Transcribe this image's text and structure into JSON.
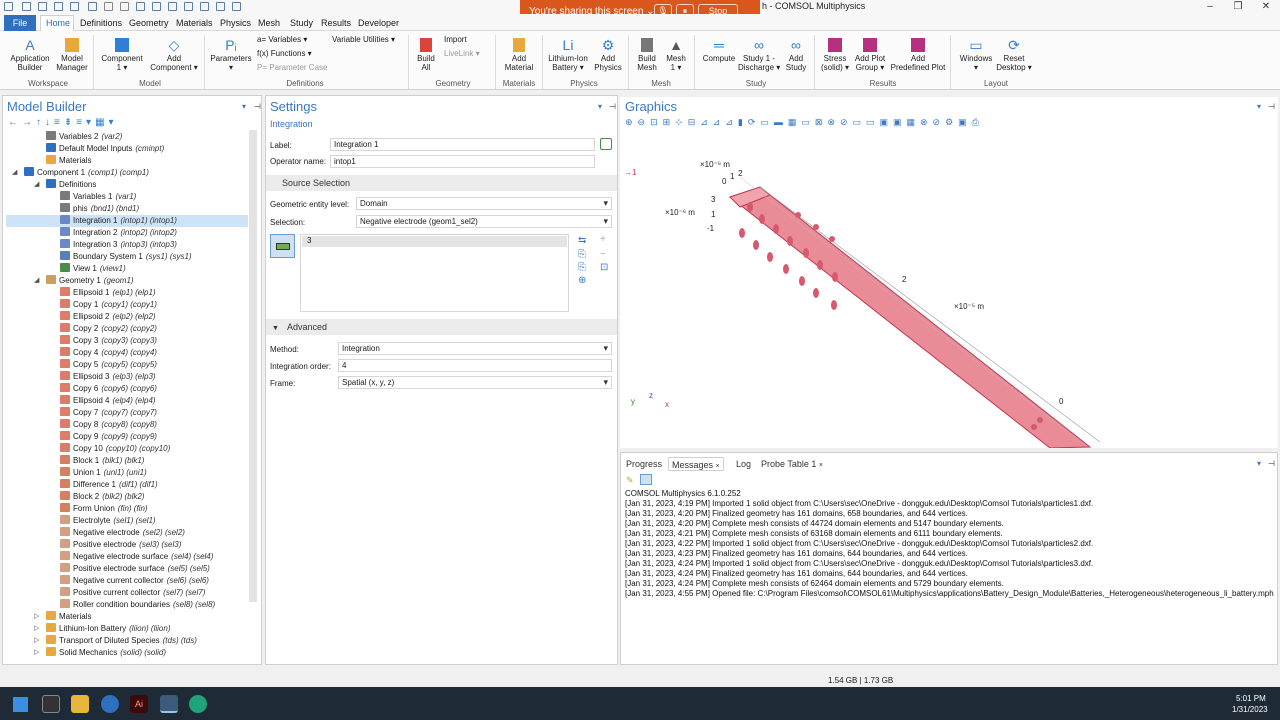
{
  "window": {
    "title": "h - COMSOL Multiphysics",
    "controls": [
      "–",
      "❐",
      "✕"
    ]
  },
  "share_bar": {
    "message": "You're sharing this screen ⌄",
    "stop_label": "Stop",
    "mic": "🎙",
    "pause": "⏸"
  },
  "menu": {
    "file": "File",
    "items": [
      "Home",
      "Definitions",
      "Geometry",
      "Materials",
      "Physics",
      "Mesh",
      "Study",
      "Results",
      "Developer"
    ]
  },
  "ribbon": {
    "application_builder": "Application\nBuilder",
    "model_manager": "Model\nManager",
    "component": "Component\n1 ▾",
    "add_component": "Add\nComponent ▾",
    "parameters": "Parameters\n▾",
    "variables": "a= Variables ▾",
    "functions": "f(x) Functions ▾",
    "parameter_case": "P= Parameter Case",
    "variable_utilities": "Variable Utilities ▾",
    "build_all": "Build\nAll",
    "import": "Import",
    "livelink": "LiveLink ▾",
    "add_material": "Add\nMaterial",
    "battery": "Lithium-Ion\nBattery ▾",
    "add_physics": "Add\nPhysics",
    "build_mesh": "Build\nMesh",
    "mesh1": "Mesh\n1 ▾",
    "compute": "Compute",
    "study1": "Study 1 -\nDischarge ▾",
    "add_study": "Add\nStudy",
    "stress": "Stress\n(solid) ▾",
    "add_plot_group": "Add Plot\nGroup ▾",
    "add_predefined_plot": "Add\nPredefined Plot",
    "windows": "Windows\n▾",
    "reset_desktop": "Reset\nDesktop ▾",
    "groups": [
      "Workspace",
      "Model",
      "Definitions",
      "Geometry",
      "Materials",
      "Physics",
      "Mesh",
      "Study",
      "Results",
      "Layout"
    ]
  },
  "model_builder": {
    "title": "Model Builder",
    "tree": [
      {
        "label": "Variables 2",
        "tag": "(var2)",
        "indent": 0,
        "icon": "var"
      },
      {
        "label": "Default Model Inputs",
        "tag": "(cminpt)",
        "indent": 0,
        "icon": "blue"
      },
      {
        "label": "Materials",
        "tag": "",
        "indent": 0,
        "icon": "mat"
      },
      {
        "label": "Component 1",
        "tag": "(comp1) (comp1)",
        "indent": -1,
        "icon": "comp"
      },
      {
        "label": "Definitions",
        "tag": "",
        "indent": 0,
        "icon": "blue"
      },
      {
        "label": "Variables 1",
        "tag": "(var1)",
        "indent": 1,
        "icon": "var"
      },
      {
        "label": "phis",
        "tag": "(bnd1) (bnd1)",
        "indent": 1,
        "icon": "var"
      },
      {
        "label": "Integration 1",
        "tag": "(intop1) (intop1)",
        "indent": 1,
        "icon": "fn",
        "selected": true
      },
      {
        "label": "Integration 2",
        "tag": "(intop2) (intop2)",
        "indent": 1,
        "icon": "fn"
      },
      {
        "label": "Integration 3",
        "tag": "(intop3) (intop3)",
        "indent": 1,
        "icon": "fn"
      },
      {
        "label": "Boundary System 1",
        "tag": "(sys1) (sys1)",
        "indent": 1,
        "icon": "sys"
      },
      {
        "label": "View 1",
        "tag": "(view1)",
        "indent": 1,
        "icon": "view"
      },
      {
        "label": "Geometry 1",
        "tag": "(geom1)",
        "indent": 0,
        "icon": "geom"
      },
      {
        "label": "Ellipsoid 1",
        "tag": "(elp1) (elp1)",
        "indent": 1,
        "icon": "ell"
      },
      {
        "label": "Copy 1",
        "tag": "(copy1) (copy1)",
        "indent": 1,
        "icon": "copy"
      },
      {
        "label": "Ellipsoid 2",
        "tag": "(elp2) (elp2)",
        "indent": 1,
        "icon": "ell"
      },
      {
        "label": "Copy 2",
        "tag": "(copy2) (copy2)",
        "indent": 1,
        "icon": "copy"
      },
      {
        "label": "Copy 3",
        "tag": "(copy3) (copy3)",
        "indent": 1,
        "icon": "copy"
      },
      {
        "label": "Copy 4",
        "tag": "(copy4) (copy4)",
        "indent": 1,
        "icon": "copy"
      },
      {
        "label": "Copy 5",
        "tag": "(copy5) (copy5)",
        "indent": 1,
        "icon": "copy"
      },
      {
        "label": "Ellipsoid 3",
        "tag": "(elp3) (elp3)",
        "indent": 1,
        "icon": "ell"
      },
      {
        "label": "Copy 6",
        "tag": "(copy6) (copy6)",
        "indent": 1,
        "icon": "copy"
      },
      {
        "label": "Ellipsoid 4",
        "tag": "(elp4) (elp4)",
        "indent": 1,
        "icon": "ell"
      },
      {
        "label": "Copy 7",
        "tag": "(copy7) (copy7)",
        "indent": 1,
        "icon": "copy"
      },
      {
        "label": "Copy 8",
        "tag": "(copy8) (copy8)",
        "indent": 1,
        "icon": "copy"
      },
      {
        "label": "Copy 9",
        "tag": "(copy9) (copy9)",
        "indent": 1,
        "icon": "copy"
      },
      {
        "label": "Copy 10",
        "tag": "(copy10) (copy10)",
        "indent": 1,
        "icon": "copy"
      },
      {
        "label": "Block 1",
        "tag": "(blk1) (blk1)",
        "indent": 1,
        "icon": "block"
      },
      {
        "label": "Union 1",
        "tag": "(uni1) (uni1)",
        "indent": 1,
        "icon": "union"
      },
      {
        "label": "Difference 1",
        "tag": "(dif1) (dif1)",
        "indent": 1,
        "icon": "union"
      },
      {
        "label": "Block 2",
        "tag": "(blk2) (blk2)",
        "indent": 1,
        "icon": "block"
      },
      {
        "label": "Form Union",
        "tag": "(fin) (fin)",
        "indent": 1,
        "icon": "block"
      },
      {
        "label": "Electrolyte",
        "tag": "(sel1) (sel1)",
        "indent": 1,
        "icon": "sel"
      },
      {
        "label": "Negative electrode",
        "tag": "(sel2) (sel2)",
        "indent": 1,
        "icon": "sel"
      },
      {
        "label": "Positive electrode",
        "tag": "(sel3) (sel3)",
        "indent": 1,
        "icon": "sel"
      },
      {
        "label": "Negative electrode surface",
        "tag": "(sel4) (sel4)",
        "indent": 1,
        "icon": "sel"
      },
      {
        "label": "Positive electrode surface",
        "tag": "(sel5) (sel5)",
        "indent": 1,
        "icon": "sel"
      },
      {
        "label": "Negative current collector",
        "tag": "(sel6) (sel6)",
        "indent": 1,
        "icon": "sel"
      },
      {
        "label": "Positive current collector",
        "tag": "(sel7) (sel7)",
        "indent": 1,
        "icon": "sel"
      },
      {
        "label": "Roller condition boundaries",
        "tag": "(sel8) (sel8)",
        "indent": 1,
        "icon": "sel"
      },
      {
        "label": "Materials",
        "tag": "",
        "indent": 0,
        "icon": "mat",
        "collapsed": true
      },
      {
        "label": "Lithium-Ion Battery",
        "tag": "(liion) (liion)",
        "indent": 0,
        "icon": "phys",
        "collapsed": true
      },
      {
        "label": "Transport of Diluted Species",
        "tag": "(tds) (tds)",
        "indent": 0,
        "icon": "phys",
        "collapsed": true
      },
      {
        "label": "Solid Mechanics",
        "tag": "(solid) (solid)",
        "indent": 0,
        "icon": "phys",
        "collapsed": true
      }
    ]
  },
  "settings": {
    "title": "Settings",
    "subtitle": "Integration",
    "label_caption": "Label:",
    "label_value": "Integration 1",
    "operator_caption": "Operator name:",
    "operator_value": "intop1",
    "source_selection": "Source Selection",
    "entity_level_caption": "Geometric entity level:",
    "entity_level_value": "Domain",
    "selection_caption": "Selection:",
    "selection_value": "Negative electrode (geom1_sel2)",
    "selection_list": [
      "3"
    ],
    "advanced": "Advanced",
    "method_caption": "Method:",
    "method_value": "Integration",
    "order_caption": "Integration order:",
    "order_value": "4",
    "frame_caption": "Frame:",
    "frame_value": "Spatial  (x, y, z)"
  },
  "graphics": {
    "title": "Graphics",
    "scale_top": "×10⁻⁶ m",
    "scale_left": "×10⁻⁶ m",
    "scale_mid": "×10⁻⁵ m",
    "tick_labels": [
      "0",
      "1",
      "2",
      "3",
      "1",
      "-1",
      "2",
      "0"
    ],
    "marker": "→1",
    "axes": {
      "y": "y",
      "z": "z",
      "x": "x"
    },
    "accent": "#e8838f"
  },
  "messages": {
    "tabs": [
      "Progress",
      "Messages",
      "Log",
      "Probe Table 1"
    ],
    "lines": [
      "COMSOL Multiphysics 6.1.0.252",
      "[Jan 31, 2023, 4:19 PM] Imported 1 solid object from C:\\Users\\sec\\OneDrive - dongguk.edu\\Desktop\\Comsol Tutorials\\particles1.dxf.",
      "[Jan 31, 2023, 4:20 PM] Finalized geometry has 161 domains, 658 boundaries, and 644 vertices.",
      "[Jan 31, 2023, 4:20 PM] Complete mesh consists of 44724 domain elements and 5147 boundary elements.",
      "[Jan 31, 2023, 4:21 PM] Complete mesh consists of 63168 domain elements and 6111 boundary elements.",
      "[Jan 31, 2023, 4:22 PM] Imported 1 solid object from C:\\Users\\sec\\OneDrive - dongguk.edu\\Desktop\\Comsol Tutorials\\particles2.dxf.",
      "[Jan 31, 2023, 4:23 PM] Finalized geometry has 161 domains, 644 boundaries, and 644 vertices.",
      "[Jan 31, 2023, 4:24 PM] Imported 1 solid object from C:\\Users\\sec\\OneDrive - dongguk.edu\\Desktop\\Comsol Tutorials\\particles3.dxf.",
      "[Jan 31, 2023, 4:24 PM] Finalized geometry has 161 domains, 644 boundaries, and 644 vertices.",
      "[Jan 31, 2023, 4:24 PM] Complete mesh consists of 62464 domain elements and 5729 boundary elements.",
      "[Jan 31, 2023, 4:55 PM] Opened file: C:\\Program Files\\comsol\\COMSOL61\\Multiphysics\\applications\\Battery_Design_Module\\Batteries,_Heterogeneous\\heterogeneous_li_battery.mph"
    ]
  },
  "status": {
    "memory": "1.54 GB | 1.73 GB"
  },
  "taskbar": {
    "time": "5:01 PM",
    "date": "1/31/2023"
  }
}
